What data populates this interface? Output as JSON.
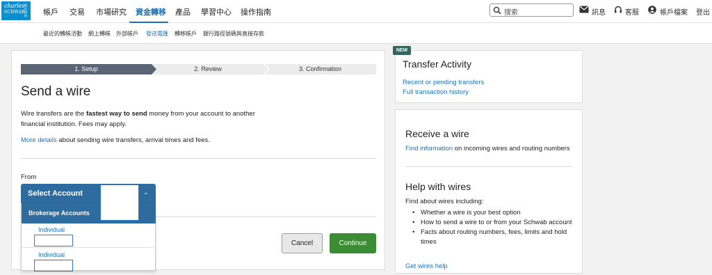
{
  "logo": {
    "line1": "charles",
    "line2": "SCHWAB",
    "side": "嘉信理財"
  },
  "nav": {
    "items": [
      "帳戶",
      "交易",
      "市場研究",
      "資金轉移",
      "產品",
      "學習中心",
      "操作指南"
    ],
    "active_index": 3,
    "search_placeholder": "搜索",
    "messages": "訊息",
    "service": "客服",
    "profile": "帳戶檔案",
    "logout": "登出"
  },
  "subnav": {
    "items": [
      "最近的轉帳活動",
      "網上轉帳",
      "外部帳戶",
      "發送電匯",
      "轉移帳戶",
      "銀行路徑號碼與直接存款"
    ],
    "active_index": 3
  },
  "steps": [
    "1. Setup",
    "2. Review",
    "3. Confirmation"
  ],
  "main": {
    "title": "Send a wire",
    "desc_part1": "Wire transfers are the ",
    "desc_bold": "fastest way to send",
    "desc_part2": " money from your account to another financial institution. Fees may apply.",
    "details_link": "More details",
    "details_rest": " about sending wire transfers, arrival times and fees.",
    "from_label": "From",
    "select_label": "Select Account",
    "dropdown_group": "Brokerage Accounts",
    "dropdown_items": [
      "Individual",
      "Individual"
    ],
    "cancel": "Cancel",
    "continue": "Continue"
  },
  "sidebar": {
    "badge": "NEW",
    "activity_title": "Transfer Activity",
    "activity_links": [
      "Recent or pending transfers",
      "Full transaction history"
    ],
    "receive_title": "Receive a wire",
    "receive_link": "Find information",
    "receive_rest": " on incoming wires and routing numbers",
    "help_title": "Help with wires",
    "help_intro": "Find about wires including:",
    "help_bullets": [
      "Whether a wire is your best option",
      "How to send a wire to or from your Schwab account",
      "Facts about routing numbers, fees, limits and hold times"
    ],
    "help_link": "Get wires help"
  },
  "colors": {
    "accent": "#1b72b9",
    "select_bg": "#2e6b9e",
    "continue_bg": "#3c8b35",
    "step_active": "#5a6573",
    "badge": "#37655f"
  }
}
